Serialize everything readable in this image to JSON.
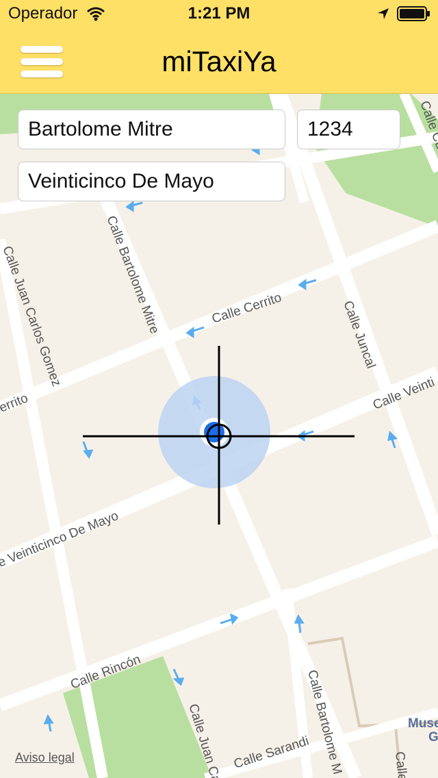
{
  "status_bar": {
    "carrier": "Operador",
    "time": "1:21 PM",
    "icons": [
      "wifi-icon",
      "location-arrow-icon",
      "battery-icon"
    ]
  },
  "nav": {
    "title": "miTaxiYa",
    "menu_icon": "hamburger-menu-icon"
  },
  "form": {
    "street": {
      "value": "Bartolome Mitre"
    },
    "number": {
      "value": "1234"
    },
    "cross_street": {
      "value": "Veinticinco De Mayo"
    }
  },
  "map": {
    "labels": {
      "cerrito": "Calle Cerrito",
      "cerrito_left": "errito",
      "bartolome_mitre": "Calle Bartolome Mitre",
      "juan_carlos_gomez": "Calle Juan Carlos Gomez",
      "juncal": "Calle Juncal",
      "veinticinco_right": "Calle Veinti",
      "veinticinco_left": "e Veinticinco De Mayo",
      "rincon": "Calle Rincón",
      "sarandi": "Calle Sarandi",
      "bartolome_mitre_bottom": "Calle Bartolome M",
      "juan_car_bottom": "Calle Juan Car",
      "museo": "Muse",
      "museo_g": "G",
      "calle_cu": "Calle Cu",
      "calle_right_bottom": "Calle"
    },
    "legal_link": "Aviso legal",
    "colors": {
      "park": "#b9dfa0",
      "road": "#ffffff",
      "land": "#f6f1e8",
      "location": "#1a6fe8",
      "accuracy": "#bcd3f2"
    }
  }
}
